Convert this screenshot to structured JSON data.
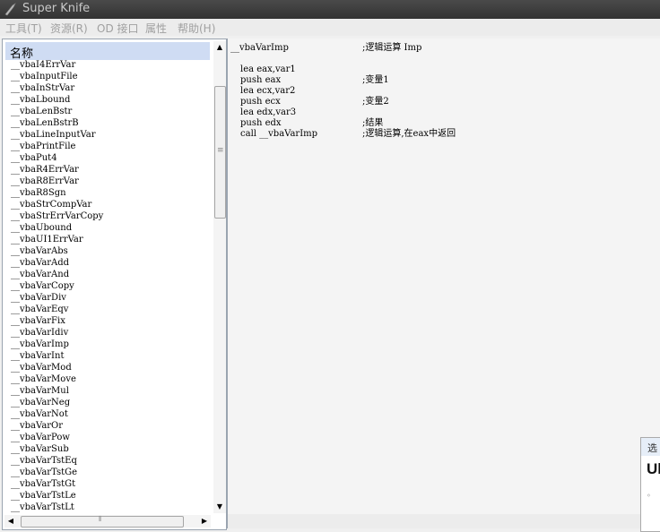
{
  "window": {
    "title": "Super Knife"
  },
  "menu": [
    "工具(T)",
    "资源(R)",
    "OD 接口",
    "属性",
    "帮助(H)"
  ],
  "list": {
    "header": "名称",
    "items": [
      "__vbaI4ErrVar",
      "__vbaInputFile",
      "__vbaInStrVar",
      "__vbaLbound",
      "__vbaLenBstr",
      "__vbaLenBstrB",
      "__vbaLineInputVar",
      "__vbaPrintFile",
      "__vbaPut4",
      "__vbaR4ErrVar",
      "__vbaR8ErrVar",
      "__vbaR8Sgn",
      "__vbaStrCompVar",
      "__vbaStrErrVarCopy",
      "__vbaUbound",
      "__vbaUI1ErrVar",
      "__vbaVarAbs",
      "__vbaVarAdd",
      "__vbaVarAnd",
      "__vbaVarCopy",
      "__vbaVarDiv",
      "__vbaVarEqv",
      "__vbaVarFix",
      "__vbaVarIdiv",
      "__vbaVarImp",
      "__vbaVarInt",
      "__vbaVarMod",
      "__vbaVarMove",
      "__vbaVarMul",
      "__vbaVarNeg",
      "__vbaVarNot",
      "__vbaVarOr",
      "__vbaVarPow",
      "__vbaVarSub",
      "__vbaVarTstEq",
      "__vbaVarTstGe",
      "__vbaVarTstGt",
      "__vbaVarTstLe",
      "__vbaVarTstLt"
    ]
  },
  "code": {
    "header": {
      "name": "__vbaVarImp",
      "comment": ";逻辑运算 Imp"
    },
    "lines": [
      {
        "op": "lea eax,var1",
        "comment": ""
      },
      {
        "op": "push eax",
        "comment": ";变量1"
      },
      {
        "op": "lea ecx,var2",
        "comment": ""
      },
      {
        "op": "push ecx",
        "comment": ";变量2"
      },
      {
        "op": "lea edx,var3",
        "comment": ""
      },
      {
        "op": "push edx",
        "comment": ";结果"
      },
      {
        "op": "call __vbaVarImp",
        "comment": ";逻辑运算,在eax中返回"
      }
    ]
  },
  "popup": {
    "header": "选",
    "title": "Ul",
    "bullet": "◦"
  },
  "icons": {
    "app": "knife-icon",
    "scroll_up": "▲",
    "scroll_down": "▼",
    "scroll_left": "◀",
    "scroll_right": "▶",
    "grip_v": "≡",
    "grip_h": "⦀"
  }
}
